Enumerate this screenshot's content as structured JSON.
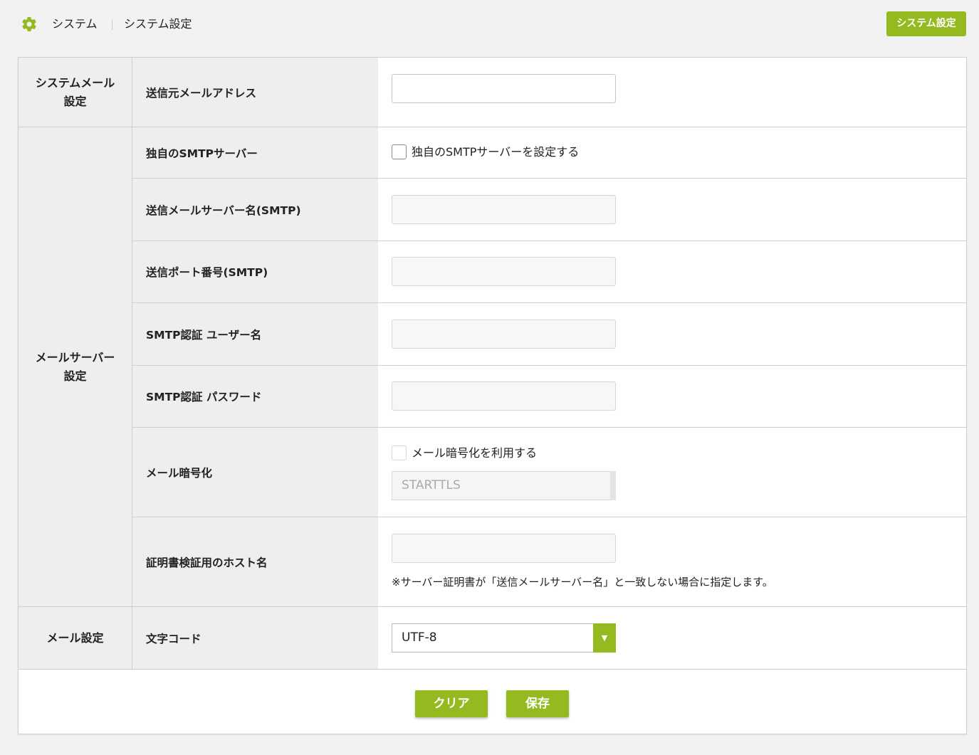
{
  "header": {
    "breadcrumb": [
      "システム",
      "システム設定"
    ],
    "top_button": "システム設定",
    "accent_color": "#95ba20"
  },
  "groups": {
    "system_mail": "システムメール\n設定",
    "mail_server": "メールサーバー\n設定",
    "mail_settings": "メール設定"
  },
  "rows": {
    "from_address": {
      "label": "送信元メールアドレス",
      "value": ""
    },
    "own_smtp": {
      "label": "独自のSMTPサーバー",
      "checkbox_label": "独自のSMTPサーバーを設定する",
      "checked": false
    },
    "smtp_host": {
      "label": "送信メールサーバー名(SMTP)",
      "value": ""
    },
    "smtp_port": {
      "label": "送信ポート番号(SMTP)",
      "value": ""
    },
    "smtp_user": {
      "label": "SMTP認証 ユーザー名",
      "value": ""
    },
    "smtp_pass": {
      "label": "SMTP認証 パスワード",
      "value": ""
    },
    "encryption": {
      "label": "メール暗号化",
      "checkbox_label": "メール暗号化を利用する",
      "checked": false,
      "select_value": "STARTTLS"
    },
    "cert_host": {
      "label": "証明書検証用のホスト名",
      "value": "",
      "note": "※サーバー証明書が「送信メールサーバー名」と一致しない場合に指定します。"
    },
    "charset": {
      "label": "文字コード",
      "select_value": "UTF-8"
    }
  },
  "actions": {
    "clear": "クリア",
    "save": "保存"
  },
  "icons": {
    "gear": "gear-icon",
    "dropdown": "▼"
  }
}
